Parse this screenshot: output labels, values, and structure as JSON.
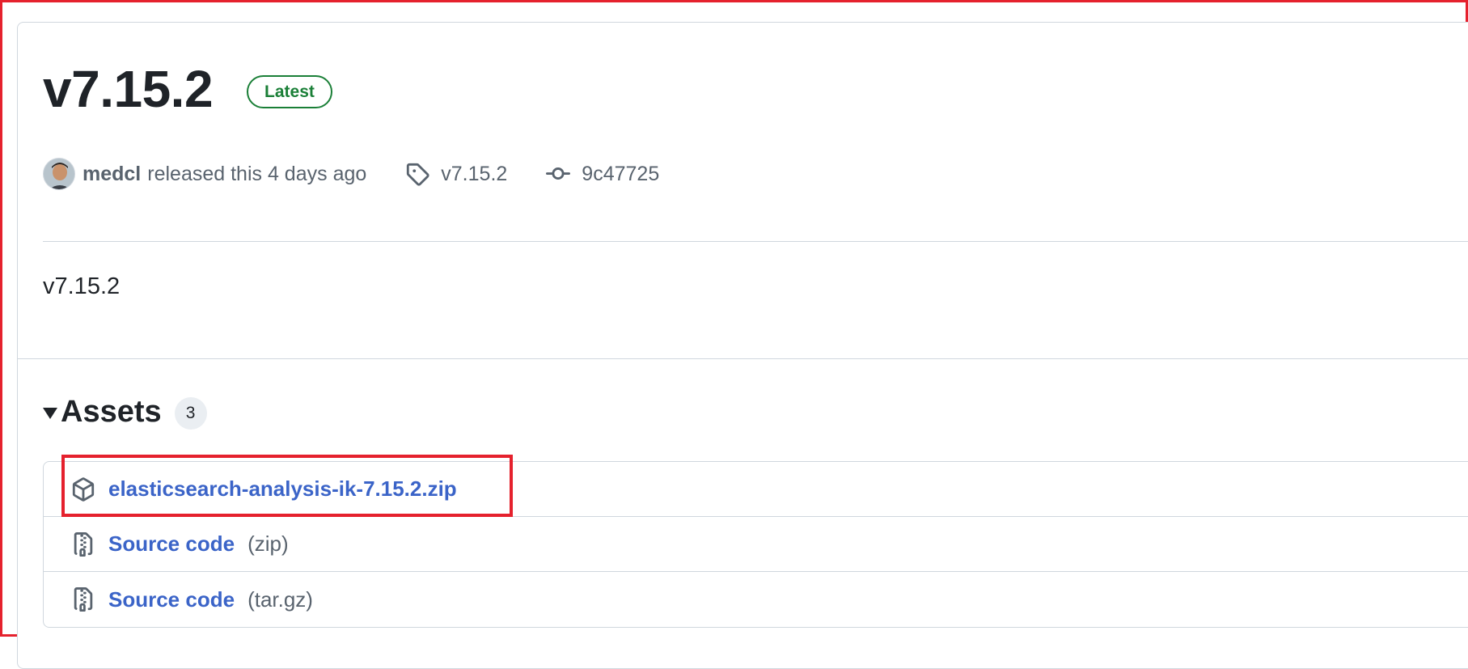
{
  "release": {
    "title": "v7.15.2",
    "badge": "Latest",
    "author": "medcl",
    "released_text": "released this 4 days ago",
    "tag": "v7.15.2",
    "commit": "9c47725",
    "body": "v7.15.2"
  },
  "assets": {
    "title": "Assets",
    "count": "3",
    "items": [
      {
        "label": "elasticsearch-analysis-ik-7.15.2.zip",
        "suffix": "",
        "icon": "package-icon"
      },
      {
        "label": "Source code",
        "suffix": "(zip)",
        "icon": "file-zip-icon"
      },
      {
        "label": "Source code",
        "suffix": "(tar.gz)",
        "icon": "file-zip-icon"
      }
    ]
  },
  "colors": {
    "highlight": "#e5212d",
    "latest_badge": "#1a7f37",
    "link": "#3b64c8"
  }
}
